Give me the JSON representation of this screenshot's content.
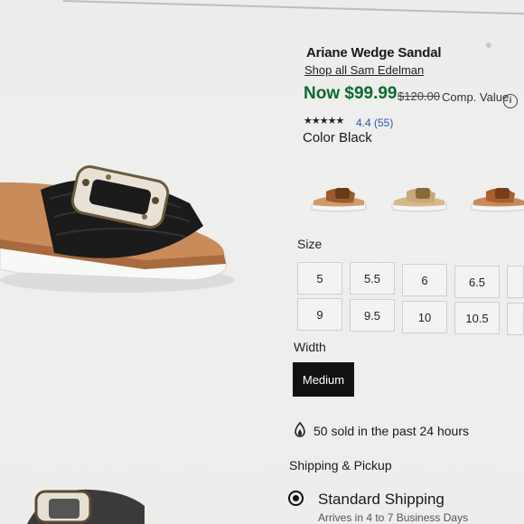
{
  "product": {
    "title": "Ariane Wedge Sandal",
    "shop_link": "Shop all Sam Edelman",
    "price_now": "Now $99.99",
    "price_was": "$120.00",
    "comp_value": "Comp. Value",
    "stars": "★★★★★",
    "rating": "4.4 (55)",
    "rating_value": 4.4,
    "color_label": "Color Black"
  },
  "swatches": [
    "cognac",
    "natural",
    "tan"
  ],
  "size": {
    "label": "Size",
    "options": [
      "5",
      "5.5",
      "6",
      "6.5",
      "9",
      "9.5",
      "10",
      "10.5"
    ]
  },
  "width": {
    "label": "Width",
    "selected": "Medium"
  },
  "social_proof": "50 sold in the past 24 hours",
  "shipping": {
    "label": "Shipping & Pickup",
    "option": "Standard Shipping",
    "arrives": "Arrives in 4 to 7 Business Days"
  },
  "colors": {
    "sale_price": "#0b6b2e",
    "rating_link": "#2a57b0",
    "selected_width": "#121212"
  }
}
